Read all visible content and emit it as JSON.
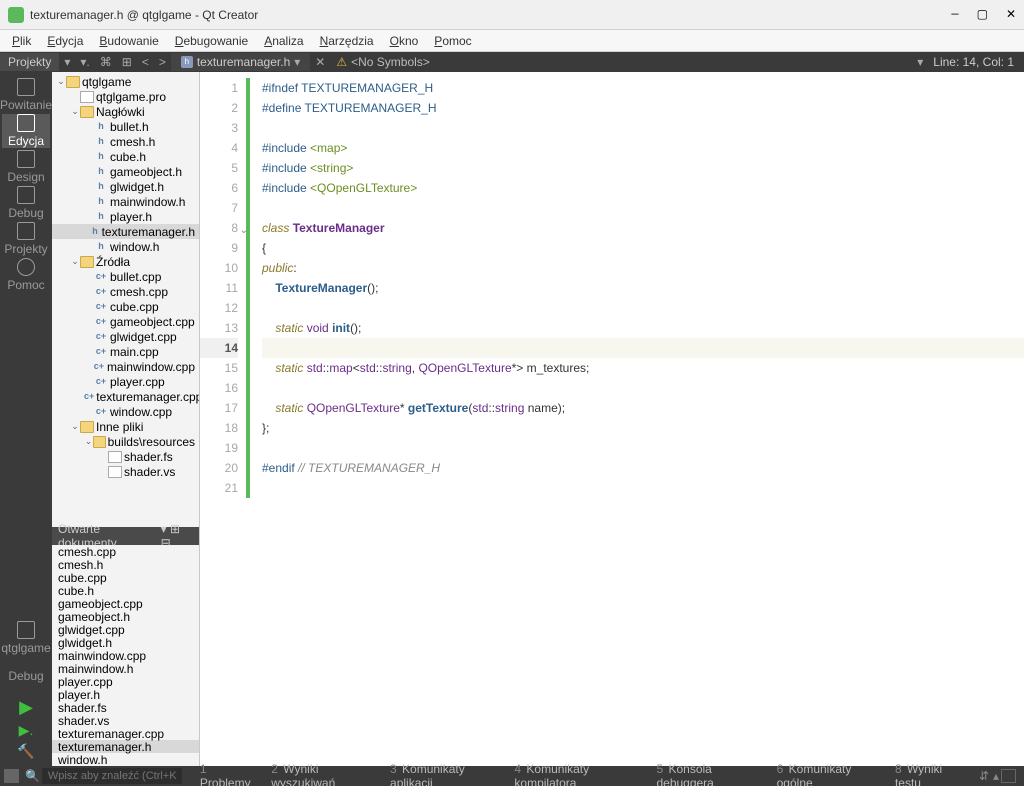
{
  "window": {
    "title": "texturemanager.h @ qtglgame - Qt Creator"
  },
  "menubar": [
    "Plik",
    "Edycja",
    "Budowanie",
    "Debugowanie",
    "Analiza",
    "Narzędzia",
    "Okno",
    "Pomoc"
  ],
  "leftbar": {
    "items": [
      {
        "label": "Powitanie"
      },
      {
        "label": "Edycja",
        "active": true
      },
      {
        "label": "Design"
      },
      {
        "label": "Debug"
      },
      {
        "label": "Projekty"
      },
      {
        "label": "Pomoc"
      }
    ],
    "target": "qtglgame",
    "debug": "Debug"
  },
  "projects_pane": {
    "title": "Projekty",
    "tree": [
      {
        "d": 0,
        "tw": "v",
        "ic": "folder",
        "label": "qtglgame"
      },
      {
        "d": 1,
        "tw": "",
        "ic": "file",
        "label": "qtglgame.pro"
      },
      {
        "d": 1,
        "tw": "v",
        "ic": "folder",
        "label": "Nagłówki"
      },
      {
        "d": 2,
        "ic": "h",
        "label": "bullet.h"
      },
      {
        "d": 2,
        "ic": "h",
        "label": "cmesh.h"
      },
      {
        "d": 2,
        "ic": "h",
        "label": "cube.h"
      },
      {
        "d": 2,
        "ic": "h",
        "label": "gameobject.h"
      },
      {
        "d": 2,
        "ic": "h",
        "label": "glwidget.h"
      },
      {
        "d": 2,
        "ic": "h",
        "label": "mainwindow.h"
      },
      {
        "d": 2,
        "ic": "h",
        "label": "player.h"
      },
      {
        "d": 2,
        "ic": "h",
        "label": "texturemanager.h",
        "sel": true
      },
      {
        "d": 2,
        "ic": "h",
        "label": "window.h"
      },
      {
        "d": 1,
        "tw": "v",
        "ic": "folder",
        "label": "Źródła"
      },
      {
        "d": 2,
        "ic": "cpp",
        "label": "bullet.cpp"
      },
      {
        "d": 2,
        "ic": "cpp",
        "label": "cmesh.cpp"
      },
      {
        "d": 2,
        "ic": "cpp",
        "label": "cube.cpp"
      },
      {
        "d": 2,
        "ic": "cpp",
        "label": "gameobject.cpp"
      },
      {
        "d": 2,
        "ic": "cpp",
        "label": "glwidget.cpp"
      },
      {
        "d": 2,
        "ic": "cpp",
        "label": "main.cpp"
      },
      {
        "d": 2,
        "ic": "cpp",
        "label": "mainwindow.cpp"
      },
      {
        "d": 2,
        "ic": "cpp",
        "label": "player.cpp"
      },
      {
        "d": 2,
        "ic": "cpp",
        "label": "texturemanager.cpp"
      },
      {
        "d": 2,
        "ic": "cpp",
        "label": "window.cpp"
      },
      {
        "d": 1,
        "tw": "v",
        "ic": "folder",
        "label": "Inne pliki"
      },
      {
        "d": 2,
        "tw": "v",
        "ic": "folder",
        "label": "builds\\resources"
      },
      {
        "d": 3,
        "ic": "file",
        "label": "shader.fs"
      },
      {
        "d": 3,
        "ic": "file",
        "label": "shader.vs"
      }
    ]
  },
  "open_docs": {
    "title": "Otwarte dokumenty",
    "items": [
      "cmesh.cpp",
      "cmesh.h",
      "cube.cpp",
      "cube.h",
      "gameobject.cpp",
      "gameobject.h",
      "glwidget.cpp",
      "glwidget.h",
      "mainwindow.cpp",
      "mainwindow.h",
      "player.cpp",
      "player.h",
      "shader.fs",
      "shader.vs",
      "texturemanager.cpp",
      "texturemanager.h",
      "window.h"
    ],
    "selected": "texturemanager.h"
  },
  "editor": {
    "file": "texturemanager.h",
    "symbols": "<No Symbols>",
    "linecol": "Line: 14, Col: 1",
    "current_line": 14,
    "lines": [
      {
        "n": 1,
        "g": true,
        "html": "<span class='kw-pre'>#ifndef</span> <span class='kw-pre'>TEXTUREMANAGER_H</span>"
      },
      {
        "n": 2,
        "g": true,
        "html": "<span class='kw-pre'>#define</span> <span class='kw-pre'>TEXTUREMANAGER_H</span>"
      },
      {
        "n": 3,
        "g": true,
        "html": ""
      },
      {
        "n": 4,
        "g": true,
        "html": "<span class='kw-pre'>#include</span> <span class='kw-inc'>&lt;map&gt;</span>"
      },
      {
        "n": 5,
        "g": true,
        "html": "<span class='kw-pre'>#include</span> <span class='kw-inc'>&lt;string&gt;</span>"
      },
      {
        "n": 6,
        "g": true,
        "html": "<span class='kw-pre'>#include</span> <span class='kw-inc'>&lt;QOpenGLTexture&gt;</span>"
      },
      {
        "n": 7,
        "g": true,
        "html": ""
      },
      {
        "n": 8,
        "g": true,
        "fold": true,
        "html": "<span class='kw'>class</span> <span class='classname'>TextureManager</span>"
      },
      {
        "n": 9,
        "g": true,
        "html": "<span class='punct'>{</span>"
      },
      {
        "n": 10,
        "g": true,
        "html": "<span class='kw'>public</span><span class='punct'>:</span>"
      },
      {
        "n": 11,
        "g": true,
        "html": "    <span class='fname'>TextureManager</span><span class='punct'>();</span>"
      },
      {
        "n": 12,
        "g": true,
        "html": ""
      },
      {
        "n": 13,
        "g": true,
        "html": "    <span class='kw'>static</span> <span class='type'>void</span> <span class='fname'>init</span><span class='punct'>();</span>"
      },
      {
        "n": 14,
        "g": true,
        "html": ""
      },
      {
        "n": 15,
        "g": true,
        "html": "    <span class='kw'>static</span> <span class='type'>std</span><span class='punct'>::</span><span class='type'>map</span><span class='punct'>&lt;</span><span class='type'>std</span><span class='punct'>::</span><span class='type'>string</span><span class='punct'>,</span> <span class='type'>QOpenGLTexture</span><span class='punct'>*&gt;</span> m_textures<span class='punct'>;</span>"
      },
      {
        "n": 16,
        "g": true,
        "html": ""
      },
      {
        "n": 17,
        "g": true,
        "html": "    <span class='kw'>static</span> <span class='type'>QOpenGLTexture</span><span class='punct'>*</span> <span class='fname'>getTexture</span><span class='punct'>(</span><span class='type'>std</span><span class='punct'>::</span><span class='type'>string</span> name<span class='punct'>);</span>"
      },
      {
        "n": 18,
        "g": true,
        "html": "<span class='punct'>};</span>"
      },
      {
        "n": 19,
        "g": true,
        "html": ""
      },
      {
        "n": 20,
        "g": true,
        "html": "<span class='kw-pre'>#endif</span> <span class='cmt'>// TEXTUREMANAGER_H</span>"
      },
      {
        "n": 21,
        "g": true,
        "html": ""
      }
    ]
  },
  "statusbar": {
    "search_placeholder": "Wpisz aby znaleźć (Ctrl+K)",
    "items": [
      {
        "n": "1",
        "label": "Problemy"
      },
      {
        "n": "2",
        "label": "Wyniki wyszukiwań"
      },
      {
        "n": "3",
        "label": "Komunikaty aplikacji"
      },
      {
        "n": "4",
        "label": "Komunikaty kompilatora"
      },
      {
        "n": "5",
        "label": "Konsola debuggera"
      },
      {
        "n": "6",
        "label": "Komunikaty ogólne"
      },
      {
        "n": "8",
        "label": "Wyniki testu"
      }
    ]
  }
}
